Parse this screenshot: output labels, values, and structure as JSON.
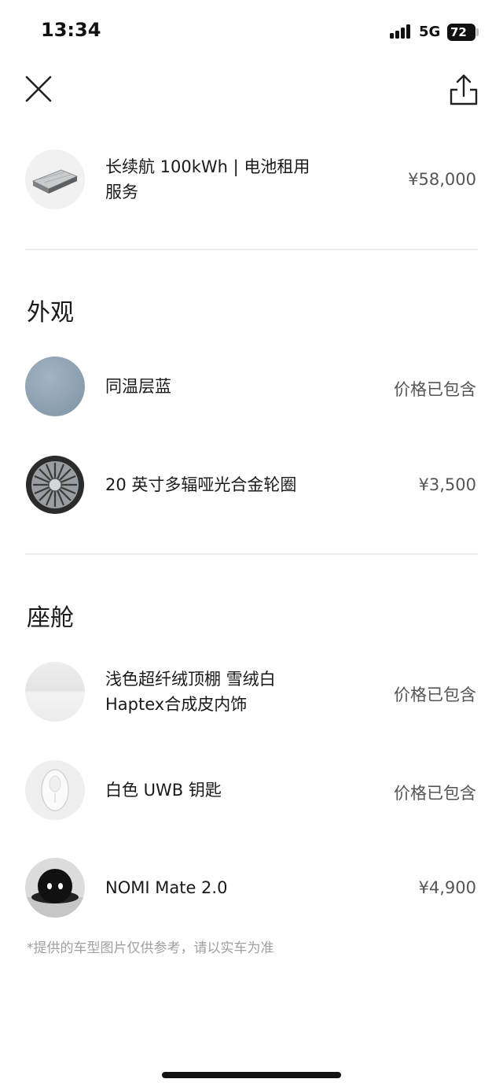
{
  "status_bar": {
    "time": "13:34",
    "network": "5G",
    "battery": "72"
  },
  "header": {
    "close_icon": "close-icon",
    "share_icon": "share-icon"
  },
  "battery_item": {
    "name_line1": "长续航 100kWh | 电池租用",
    "name_line2": "服务",
    "price": "¥58,000"
  },
  "exterior": {
    "title": "外观",
    "items": [
      {
        "name": "同温层蓝",
        "price": "价格已包含",
        "swatch": "#8fa2b3"
      },
      {
        "name": "20 英寸多辐哑光合金轮圈",
        "price": "¥3,500"
      }
    ]
  },
  "cabin": {
    "title": "座舱",
    "items": [
      {
        "name_line1": "浅色超纤绒顶棚 雪绒白",
        "name_line2": "Haptex合成皮内饰",
        "price": "价格已包含"
      },
      {
        "name": "白色 UWB 钥匙",
        "price": "价格已包含"
      },
      {
        "name": "NOMI Mate 2.0",
        "price": "¥4,900"
      }
    ]
  },
  "disclaimer": "*提供的车型图片仅供参考，请以实车为准"
}
